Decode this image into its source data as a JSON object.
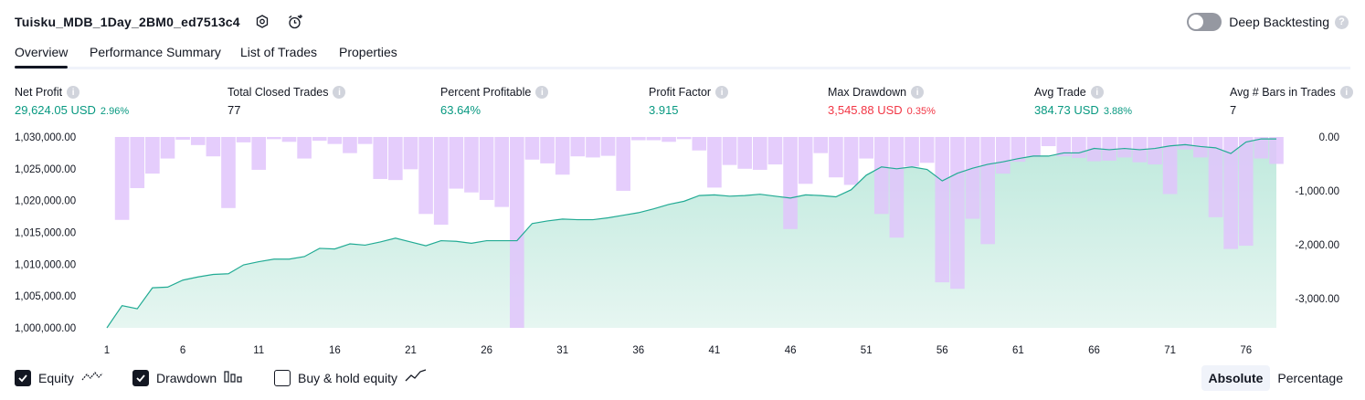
{
  "header": {
    "title": "Tuisku_MDB_1Day_2BM0_ed7513c4",
    "deep_backtesting_label": "Deep Backtesting",
    "help_mark": "?"
  },
  "tabs": [
    {
      "label": "Overview",
      "active": true
    },
    {
      "label": "Performance Summary",
      "active": false
    },
    {
      "label": "List of Trades",
      "active": false
    },
    {
      "label": "Properties",
      "active": false
    }
  ],
  "metrics": {
    "net_profit": {
      "label": "Net Profit",
      "value": "29,624.05 USD",
      "percent": "2.96%"
    },
    "total_closed_trades": {
      "label": "Total Closed Trades",
      "value": "77"
    },
    "percent_profitable": {
      "label": "Percent Profitable",
      "value": "63.64%"
    },
    "profit_factor": {
      "label": "Profit Factor",
      "value": "3.915"
    },
    "max_drawdown": {
      "label": "Max Drawdown",
      "value": "3,545.88 USD",
      "percent": "0.35%"
    },
    "avg_trade": {
      "label": "Avg Trade",
      "value": "384.73 USD",
      "percent": "3.88%"
    },
    "avg_bars": {
      "label": "Avg # Bars in Trades",
      "value": "7"
    },
    "info_mark": "i"
  },
  "colors": {
    "positive": "#089981",
    "negative": "#f23645",
    "equity_line": "#22ab94",
    "equity_fill": "#c8ece4",
    "drawdown_bar": "#e1c4fb",
    "drawdown_overlap": "#b8b4ec"
  },
  "chart_data": {
    "type": "area",
    "x_ticks": [
      1,
      6,
      11,
      16,
      21,
      26,
      31,
      36,
      41,
      46,
      51,
      56,
      61,
      66,
      71,
      76
    ],
    "y_left_ticks": [
      "1,030,000.00",
      "1,025,000.00",
      "1,020,000.00",
      "1,015,000.00",
      "1,010,000.00",
      "1,005,000.00",
      "1,000,000.00"
    ],
    "y_left_range": [
      1000000,
      1030000
    ],
    "y_right_ticks": [
      "0.00",
      "-1,000.00",
      "-2,000.00",
      "-3,000.00"
    ],
    "y_right_range": [
      -3545.88,
      0
    ],
    "series": [
      {
        "name": "Equity",
        "x": [
          1,
          2,
          3,
          4,
          5,
          6,
          7,
          8,
          9,
          10,
          11,
          12,
          13,
          14,
          15,
          16,
          17,
          18,
          19,
          20,
          21,
          22,
          23,
          24,
          25,
          26,
          27,
          28,
          29,
          30,
          31,
          32,
          33,
          34,
          35,
          36,
          37,
          38,
          39,
          40,
          41,
          42,
          43,
          44,
          45,
          46,
          47,
          48,
          49,
          50,
          51,
          52,
          53,
          54,
          55,
          56,
          57,
          58,
          59,
          60,
          61,
          62,
          63,
          64,
          65,
          66,
          67,
          68,
          69,
          70,
          71,
          72,
          73,
          74,
          75,
          76,
          77,
          78
        ],
        "values": [
          1000000,
          1003500,
          1003000,
          1006300,
          1006400,
          1007500,
          1008000,
          1008400,
          1008500,
          1009900,
          1010400,
          1010800,
          1010800,
          1011200,
          1012500,
          1012400,
          1013200,
          1013000,
          1013500,
          1014100,
          1013500,
          1012900,
          1013700,
          1013600,
          1013300,
          1013700,
          1013700,
          1013700,
          1016400,
          1016800,
          1017100,
          1017000,
          1017000,
          1017300,
          1017700,
          1018100,
          1018700,
          1019400,
          1019900,
          1020800,
          1020900,
          1020700,
          1020800,
          1021000,
          1020700,
          1020400,
          1020900,
          1020800,
          1020600,
          1021700,
          1024000,
          1025300,
          1025000,
          1025300,
          1024900,
          1023100,
          1024300,
          1025100,
          1025700,
          1026100,
          1026600,
          1027000,
          1027000,
          1027500,
          1027500,
          1028200,
          1028000,
          1028200,
          1028000,
          1028200,
          1028600,
          1028800,
          1028500,
          1028300,
          1027400,
          1029200,
          1029700,
          1029700
        ]
      },
      {
        "name": "Drawdown",
        "x": [
          1,
          2,
          3,
          4,
          5,
          6,
          7,
          8,
          9,
          10,
          11,
          12,
          13,
          14,
          15,
          16,
          17,
          18,
          19,
          20,
          21,
          22,
          23,
          24,
          25,
          26,
          27,
          28,
          29,
          30,
          31,
          32,
          33,
          34,
          35,
          36,
          37,
          38,
          39,
          40,
          41,
          42,
          43,
          44,
          45,
          46,
          47,
          48,
          49,
          50,
          51,
          52,
          53,
          54,
          55,
          56,
          57,
          58,
          59,
          60,
          61,
          62,
          63,
          64,
          65,
          66,
          67,
          68,
          69,
          70,
          71,
          72,
          73,
          74,
          75,
          76,
          77,
          78
        ],
        "values": [
          0,
          -1540,
          -950,
          -680,
          -400,
          -50,
          -150,
          -360,
          -1320,
          -100,
          -610,
          -40,
          -90,
          -400,
          -70,
          -130,
          -300,
          -130,
          -780,
          -800,
          -600,
          -1430,
          -1630,
          -960,
          -1030,
          -1170,
          -1300,
          -3545.88,
          -420,
          -490,
          -700,
          -360,
          -380,
          -350,
          -1000,
          -60,
          -60,
          -90,
          -40,
          -250,
          -940,
          -520,
          -590,
          -610,
          -510,
          -1710,
          -870,
          -300,
          -750,
          -890,
          -400,
          -1430,
          -1870,
          -550,
          -480,
          -2700,
          -2820,
          -1520,
          -1990,
          -680,
          -460,
          -370,
          -170,
          -360,
          -390,
          -450,
          -440,
          -380,
          -470,
          -510,
          -1060,
          -230,
          -380,
          -1490,
          -2080,
          -2020,
          -400,
          -500
        ]
      }
    ]
  },
  "footer": {
    "equity_label": "Equity",
    "drawdown_label": "Drawdown",
    "buy_hold_label": "Buy & hold equity",
    "absolute_label": "Absolute",
    "percentage_label": "Percentage"
  }
}
